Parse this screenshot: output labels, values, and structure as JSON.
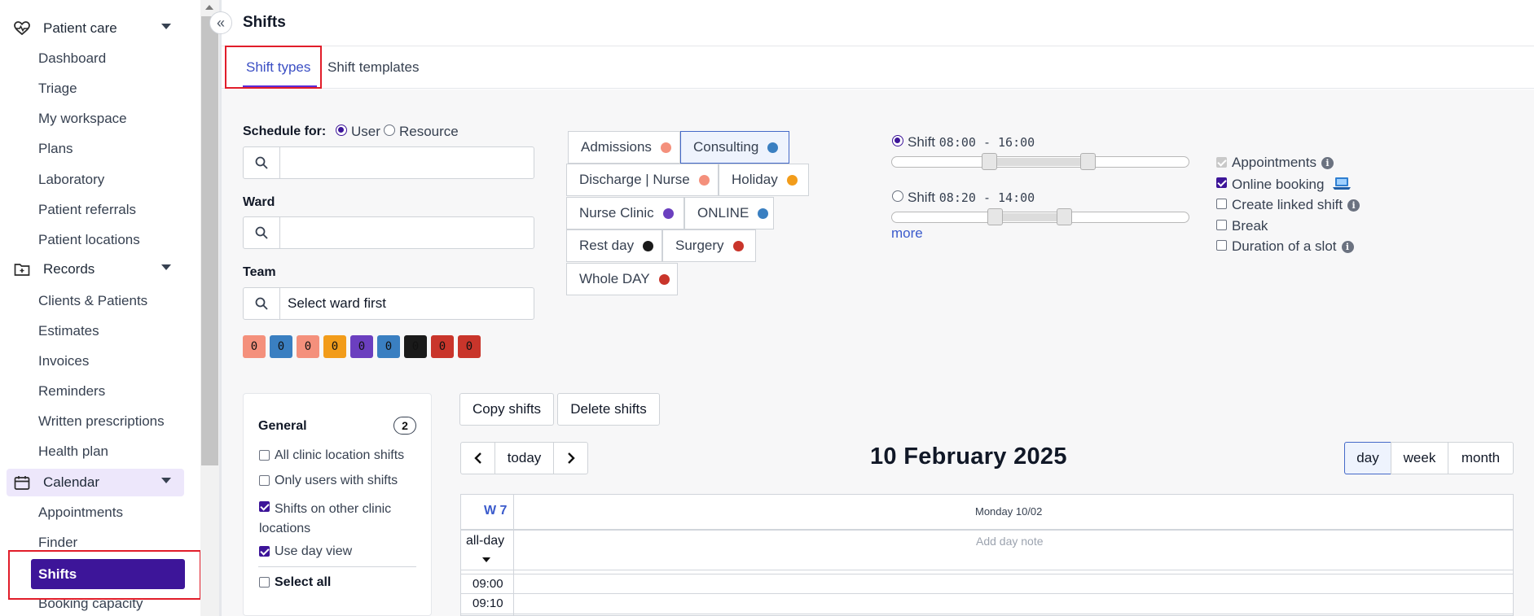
{
  "sidebar": {
    "sections": [
      {
        "label": "Patient care",
        "icon": "heart-pulse-icon"
      },
      {
        "label": "Records",
        "icon": "folder-icon"
      },
      {
        "label": "Calendar",
        "icon": "calendar-icon"
      }
    ],
    "patient_care_items": [
      "Dashboard",
      "Triage",
      "My workspace",
      "Plans",
      "Laboratory",
      "Patient referrals",
      "Patient locations"
    ],
    "records_items": [
      "Clients & Patients",
      "Estimates",
      "Invoices",
      "Reminders",
      "Written prescriptions",
      "Health plan"
    ],
    "calendar_items": [
      "Appointments",
      "Finder",
      "Shifts",
      "Booking capacity"
    ]
  },
  "header": {
    "title": "Shifts",
    "collapse_icon": "double-chevron-left-icon"
  },
  "tabs": [
    "Shift types",
    "Shift templates"
  ],
  "filters": {
    "schedule_for_label": "Schedule for:",
    "schedule_options": [
      "User",
      "Resource"
    ],
    "schedule_selected": "User",
    "user_search_value": "",
    "ward_label": "Ward",
    "ward_search_value": "",
    "team_label": "Team",
    "team_search_value": "Select ward first",
    "swatches": [
      {
        "value": "0",
        "color": "#f4907c"
      },
      {
        "value": "0",
        "color": "#3a7fc1"
      },
      {
        "value": "0",
        "color": "#f4907c"
      },
      {
        "value": "0",
        "color": "#f29c1a"
      },
      {
        "value": "0",
        "color": "#6b3fbf"
      },
      {
        "value": "0",
        "color": "#3a7fc1"
      },
      {
        "value": "0",
        "color": "#1a1a1a"
      },
      {
        "value": "0",
        "color": "#c9352b"
      },
      {
        "value": "0",
        "color": "#c9352b"
      }
    ]
  },
  "shift_types": [
    {
      "label": "Admissions",
      "color": "#f4907c",
      "selected": false
    },
    {
      "label": "Consulting",
      "color": "#3a7fc1",
      "selected": true
    },
    {
      "label": "Discharge | Nurse",
      "color": "#f4907c",
      "selected": false
    },
    {
      "label": "Holiday",
      "color": "#f29c1a",
      "selected": false
    },
    {
      "label": "Nurse Clinic",
      "color": "#6b3fbf",
      "selected": false
    },
    {
      "label": "ONLINE",
      "color": "#3a7fc1",
      "selected": false
    },
    {
      "label": "Rest day",
      "color": "#1a1a1a",
      "selected": false
    },
    {
      "label": "Surgery",
      "color": "#c9352b",
      "selected": false
    },
    {
      "label": "Whole DAY",
      "color": "#c9352b",
      "selected": false
    }
  ],
  "shift_times": [
    {
      "label": "Shift",
      "time": "08:00 - 16:00",
      "selected": true
    },
    {
      "label": "Shift",
      "time": "08:20 - 14:00",
      "selected": false
    }
  ],
  "more_label": "more",
  "options": [
    {
      "label": "Appointments",
      "checked": true,
      "disabled": true,
      "info": true
    },
    {
      "label": "Online booking",
      "checked": true,
      "disabled": false,
      "info": false,
      "icon": "laptop-icon"
    },
    {
      "label": "Create linked shift",
      "checked": false,
      "disabled": false,
      "info": true
    },
    {
      "label": "Break",
      "checked": false,
      "disabled": false,
      "info": false
    },
    {
      "label": "Duration of a slot",
      "checked": false,
      "disabled": false,
      "info": true
    }
  ],
  "general": {
    "title": "General",
    "count": "2",
    "items": [
      {
        "label": "All clinic location shifts",
        "checked": false
      },
      {
        "label": "Only users with shifts",
        "checked": false
      },
      {
        "label": "Shifts on other clinic locations",
        "checked": true
      },
      {
        "label": "Use day view",
        "checked": true
      }
    ],
    "select_all": "Select all"
  },
  "actions": {
    "copy": "Copy shifts",
    "delete": "Delete shifts"
  },
  "calendar": {
    "today": "today",
    "title": "10 February 2025",
    "views": [
      "day",
      "week",
      "month"
    ],
    "active_view": "day",
    "week": "W 7",
    "day_header": "Monday 10/02",
    "allday": "all-day",
    "day_note": "Add day note",
    "times": [
      "09:00",
      "09:10"
    ]
  }
}
